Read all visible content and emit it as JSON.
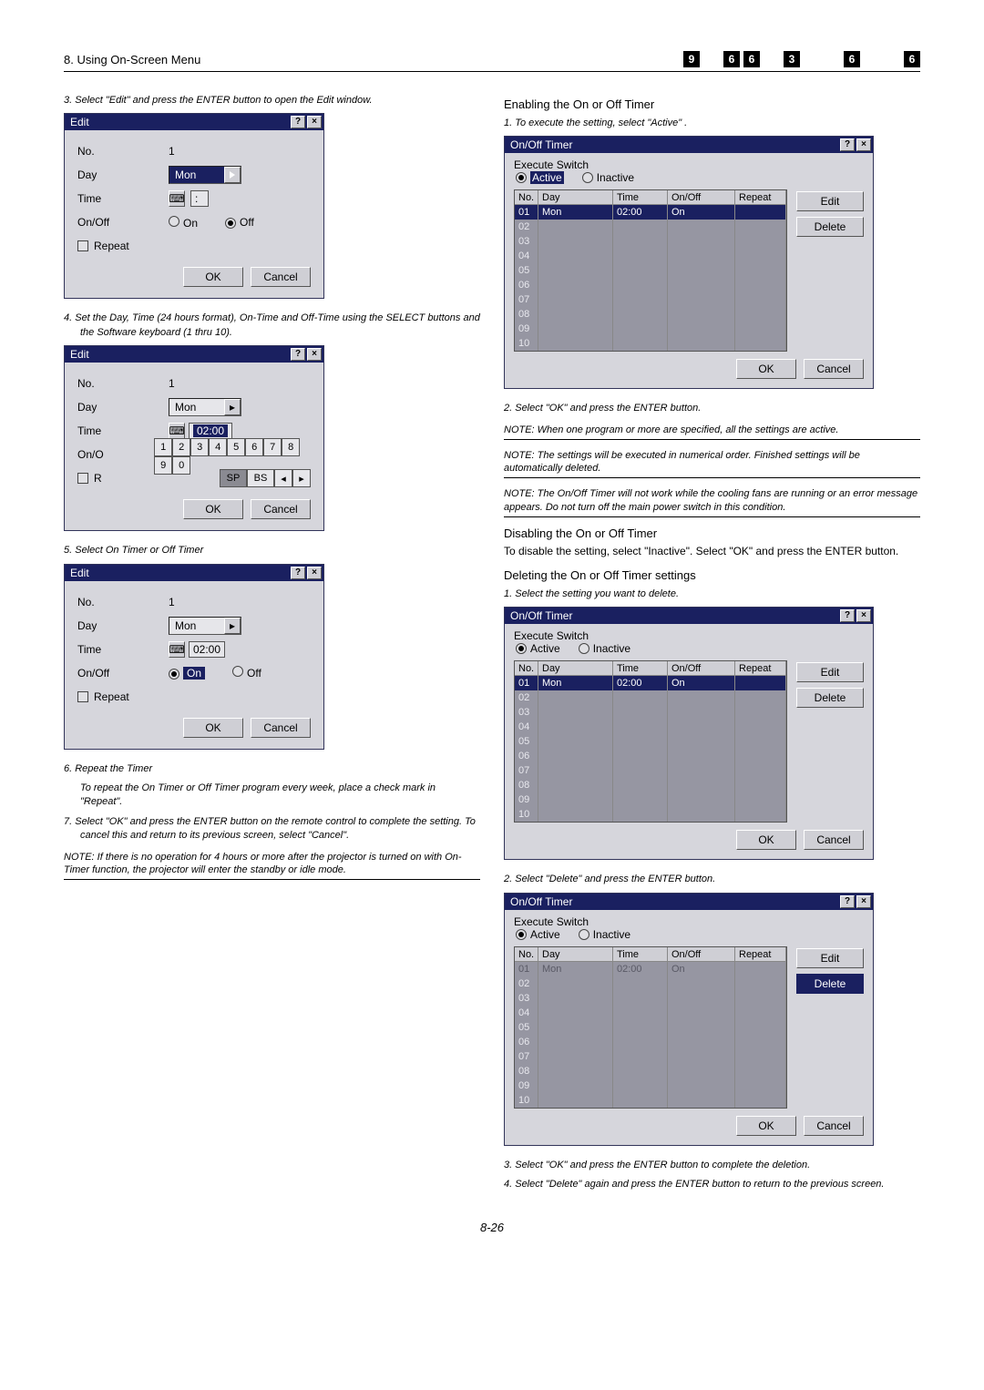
{
  "topbar": {
    "section": "8. Using On-Screen Menu",
    "boxes": [
      "9",
      "",
      "6",
      "6",
      "",
      "3",
      "",
      "",
      "6",
      "",
      "",
      "6"
    ]
  },
  "leftcol": {
    "step3": "3. Select \"Edit\" and press the ENTER button to open the Edit window.",
    "step4": "4. Set the Day, Time (24 hours format), On-Time and Off-Time using the SELECT buttons and the Software keyboard (1 thru 10).",
    "step5": "5. Select On Timer or Off Timer",
    "step6": "6. Repeat the Timer",
    "step6b": "To repeat the On Timer or Off Timer program every week, place a check mark in \"Repeat\".",
    "step7": "7. Select \"OK\" and press the ENTER button on the remote control to complete the setting. To cancel this and return to its previous screen, select \"Cancel\".",
    "note": "NOTE: If there is no operation for 4 hours or more after the projector is turned on with On-Timer function, the projector will enter the standby or idle mode."
  },
  "editwin": {
    "title": "Edit",
    "no_label": "No.",
    "no_value": "1",
    "day_label": "Day",
    "day_value": "Mon",
    "time_label": "Time",
    "time_value": "02:00",
    "onoff_label": "On/Off",
    "onoff_short": "On/O",
    "on_label": "On",
    "off_label": "Off",
    "repeat_label": "Repeat",
    "repeat_short": "R",
    "ok": "OK",
    "cancel": "Cancel",
    "keys": [
      "1",
      "2",
      "3",
      "4",
      "5",
      "6",
      "7",
      "8",
      "9",
      "0"
    ],
    "sp": "SP",
    "bs": "BS"
  },
  "rightcol": {
    "h1": "Enabling the On or Off Timer",
    "s1": "1. To execute the setting, select \"Active\" .",
    "s2": "2. Select \"OK\" and press the ENTER button.",
    "note1": "NOTE: When one program or more are specified, all the settings are active.",
    "note2": "NOTE: The settings will be executed in numerical order. Finished settings will be automatically deleted.",
    "note3": "NOTE: The On/Off Timer will not work while the cooling fans are running or an error message appears. Do not turn off the main power switch in this condition.",
    "h2": "Disabling the On or Off Timer",
    "h2b": "To disable the setting, select \"Inactive\". Select \"OK\" and press the ENTER button.",
    "h3": "Deleting the On or Off Timer settings",
    "d1": "1. Select the setting you want to delete.",
    "d2": "2. Select \"Delete\" and press the ENTER button.",
    "d3": "3. Select \"OK\" and press the ENTER button to complete the deletion.",
    "d4": "4. Select \"Delete\" again and press the ENTER button to return to the previous screen."
  },
  "timerwin": {
    "title": "On/Off Timer",
    "execute": "Execute Switch",
    "active": "Active",
    "inactive": "Inactive",
    "head": {
      "no": "No.",
      "day": "Day",
      "time": "Time",
      "onoff": "On/Off",
      "repeat": "Repeat"
    },
    "rows": [
      "01",
      "02",
      "03",
      "04",
      "05",
      "06",
      "07",
      "08",
      "09",
      "10"
    ],
    "row1": {
      "day": "Mon",
      "time": "02:00",
      "onoff": "On",
      "repeat": ""
    },
    "edit": "Edit",
    "delete": "Delete",
    "ok": "OK",
    "cancel": "Cancel"
  },
  "pagenum": "8-26"
}
